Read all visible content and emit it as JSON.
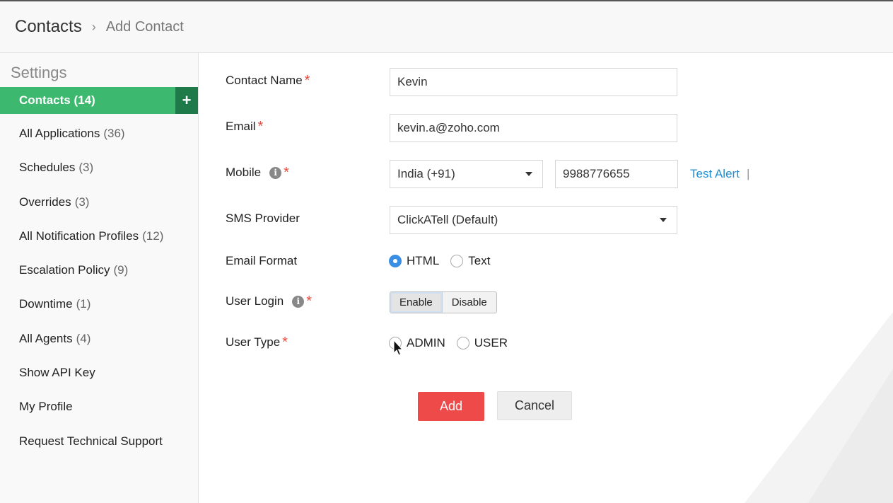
{
  "breadcrumb": {
    "main": "Contacts",
    "separator": "›",
    "current": "Add Contact"
  },
  "sidebar": {
    "title": "Settings",
    "active": {
      "label": "Contacts (14)",
      "add_symbol": "+"
    },
    "items": [
      {
        "label": "All Applications",
        "count": "(36)"
      },
      {
        "label": "Schedules",
        "count": "(3)"
      },
      {
        "label": "Overrides",
        "count": "(3)"
      },
      {
        "label": "All Notification Profiles",
        "count": "(12)"
      },
      {
        "label": "Escalation Policy",
        "count": "(9)"
      },
      {
        "label": "Downtime",
        "count": "(1)"
      },
      {
        "label": "All Agents",
        "count": "(4)"
      },
      {
        "label": "Show API Key",
        "count": ""
      },
      {
        "label": "My Profile",
        "count": ""
      },
      {
        "label": "Request Technical Support",
        "count": ""
      }
    ]
  },
  "form": {
    "contact_name": {
      "label": "Contact Name",
      "required": "*",
      "value": "Kevin"
    },
    "email": {
      "label": "Email",
      "required": "*",
      "value": "kevin.a@zoho.com"
    },
    "mobile": {
      "label": "Mobile",
      "info": "i",
      "required": "*",
      "country": "India (+91)",
      "number": "9988776655",
      "test_alert": "Test Alert",
      "pipe": "|"
    },
    "sms_provider": {
      "label": "SMS Provider",
      "value": "ClickATell (Default)"
    },
    "email_format": {
      "label": "Email Format",
      "options": [
        "HTML",
        "Text"
      ],
      "selected": "HTML"
    },
    "user_login": {
      "label": "User Login",
      "info": "i",
      "required": "*",
      "enable": "Enable",
      "disable": "Disable",
      "selected": "Enable"
    },
    "user_type": {
      "label": "User Type",
      "required": "*",
      "options": [
        "ADMIN",
        "USER"
      ],
      "selected": ""
    }
  },
  "actions": {
    "add": "Add",
    "cancel": "Cancel"
  },
  "colors": {
    "accent_green": "#3cb96f",
    "add_button": "#ee4a4a",
    "link": "#1f8fd1",
    "required": "#e74c3c",
    "radio_checked": "#3a8fe4"
  }
}
